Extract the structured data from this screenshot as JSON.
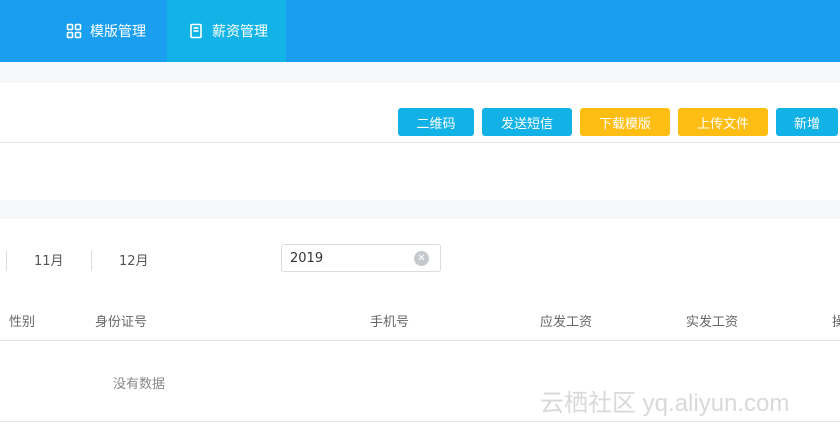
{
  "nav": {
    "tabs": [
      {
        "label": "模版管理",
        "icon": "grid-icon"
      },
      {
        "label": "薪资管理",
        "icon": "document-icon",
        "active": true
      }
    ]
  },
  "toolbar": {
    "qrcode_label": "二维码",
    "sms_label": "发送短信",
    "download_label": "下载模版",
    "upload_label": "上传文件",
    "add_label": "新增"
  },
  "filters": {
    "months": [
      "11月",
      "12月"
    ],
    "year_value": "2019"
  },
  "table": {
    "columns": [
      "性别",
      "身份证号",
      "手机号",
      "应发工资",
      "实发工资",
      "操"
    ],
    "empty_text": "没有数据"
  },
  "watermark": "云栖社区 yq.aliyun.com",
  "colors": {
    "topbar": "#1a9ff0",
    "active_tab": "#12b4e7",
    "button_blue": "#12b2e6",
    "button_yellow": "#fdbd12"
  }
}
